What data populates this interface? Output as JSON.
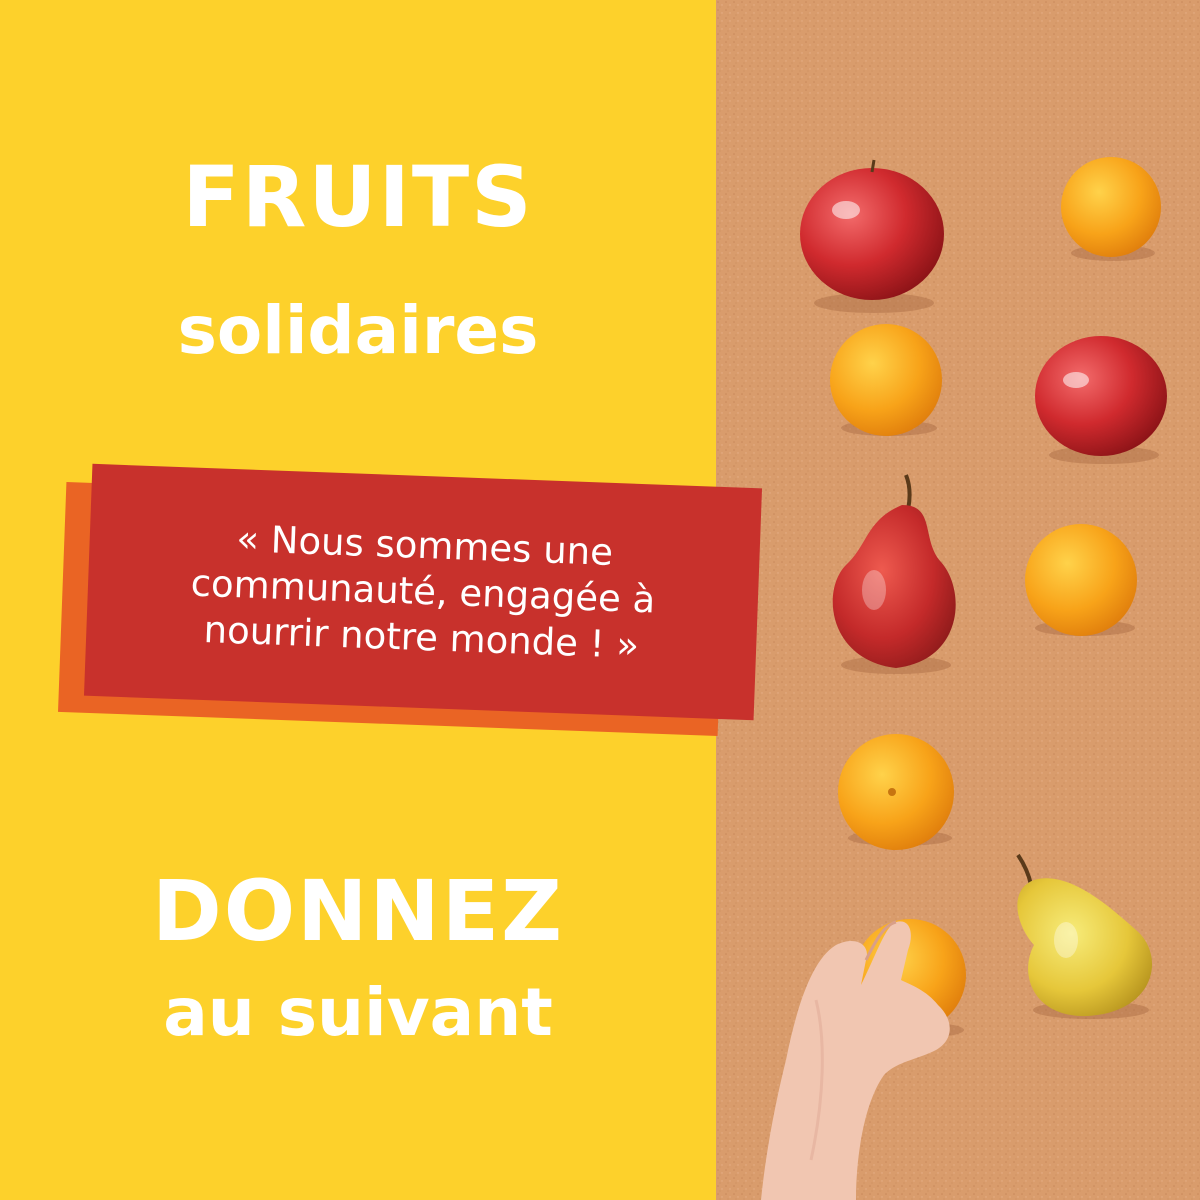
{
  "title_top": "FRUITS",
  "subtitle_top": "solidaires",
  "quote": "« Nous sommes une communauté, engagée à nourrir notre monde ! »",
  "title_bottom": "DONNEZ",
  "subtitle_bottom": "au suivant",
  "colors": {
    "background": "#fdd12b",
    "quote_box": "#c8312c",
    "quote_shadow": "#ea6424",
    "cork": "#d89a6a",
    "text": "#ffffff"
  },
  "photo": {
    "fruits": [
      "apple",
      "orange",
      "orange",
      "apple",
      "pear",
      "orange",
      "orange",
      "orange",
      "pear"
    ],
    "hand": true
  }
}
